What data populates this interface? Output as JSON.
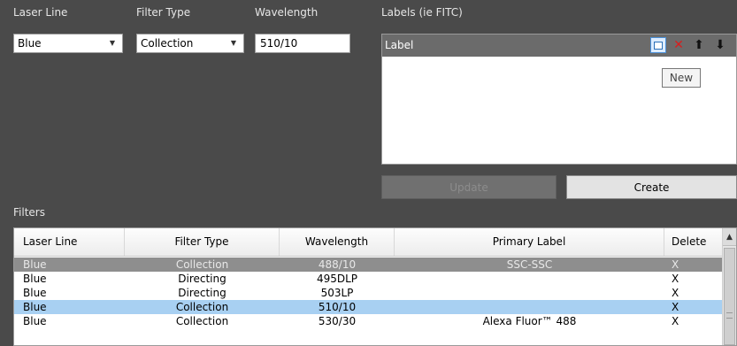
{
  "form": {
    "laser_line_label": "Laser Line",
    "filter_type_label": "Filter Type",
    "wavelength_label": "Wavelength",
    "labels_label": "Labels (ie FITC)",
    "laser_line_value": "Blue",
    "filter_type_value": "Collection",
    "wavelength_value": "510/10"
  },
  "labels_panel": {
    "header": "Label",
    "toolbar_icons": [
      "new-icon",
      "delete-icon",
      "arrow-up-icon",
      "arrow-down-icon"
    ],
    "tooltip": "New"
  },
  "buttons": {
    "update": "Update",
    "create": "Create"
  },
  "filters": {
    "section_label": "Filters",
    "columns": [
      "Laser Line",
      "Filter Type",
      "Wavelength",
      "Primary Label",
      "Delete"
    ],
    "rows": [
      {
        "laser": "Blue",
        "type": "Collection",
        "wavelength": "488/10",
        "label": "SSC-SSC",
        "delete": "X",
        "state": "disabled"
      },
      {
        "laser": "Blue",
        "type": "Directing",
        "wavelength": "495DLP",
        "label": "",
        "delete": "X",
        "state": "normal"
      },
      {
        "laser": "Blue",
        "type": "Directing",
        "wavelength": "503LP",
        "label": "",
        "delete": "X",
        "state": "normal"
      },
      {
        "laser": "Blue",
        "type": "Collection",
        "wavelength": "510/10",
        "label": "",
        "delete": "X",
        "state": "selected"
      },
      {
        "laser": "Blue",
        "type": "Collection",
        "wavelength": "530/30",
        "label": "Alexa Fluor™ 488",
        "delete": "X",
        "state": "normal"
      }
    ]
  },
  "colors": {
    "background": "#4a4a4a",
    "selected_row": "#a8d0f2",
    "disabled_row": "#8e8e8e",
    "delete_icon": "#d81e1e"
  }
}
